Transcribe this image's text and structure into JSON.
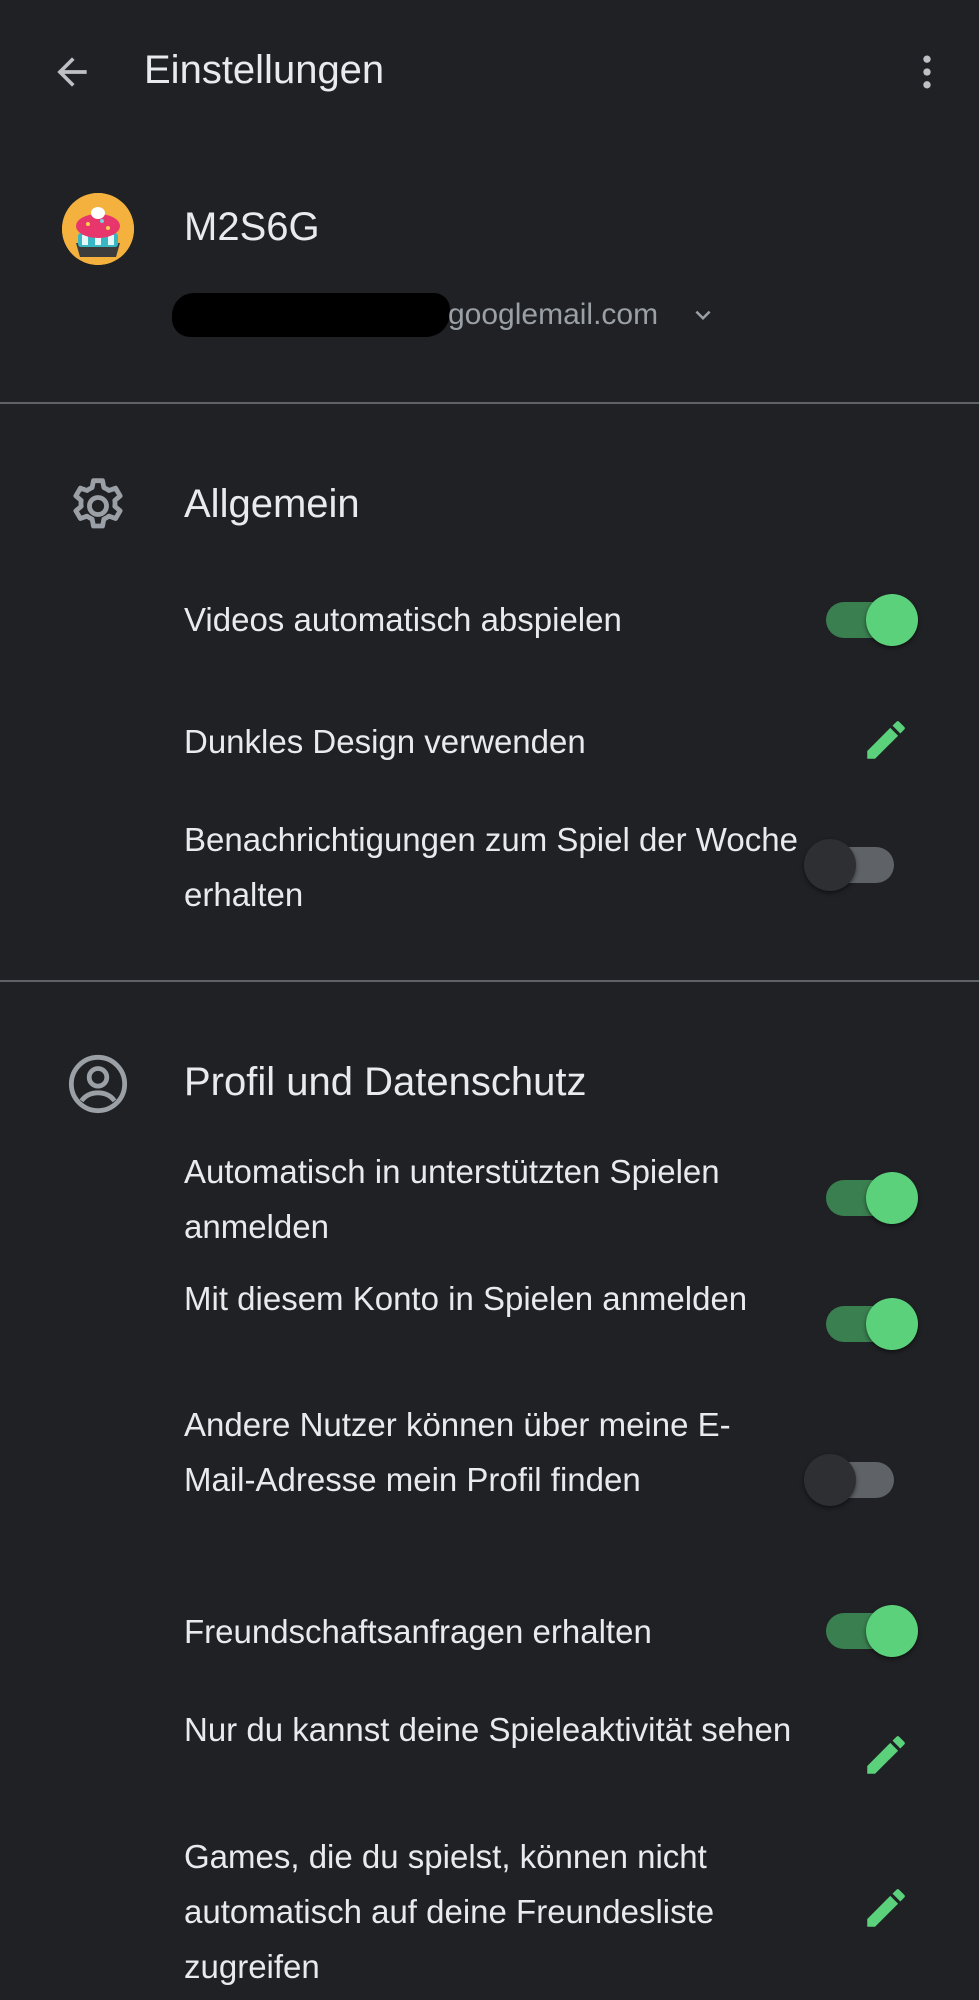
{
  "appbar": {
    "title": "Einstellungen",
    "back_icon": "arrow-back-icon",
    "more_icon": "more-vert-icon"
  },
  "account": {
    "name": "M2S6G",
    "email_visible": "googlemail.com",
    "avatar_icon": "cupcake-avatar-icon",
    "expand_icon": "chevron-down-icon"
  },
  "sections": {
    "general": {
      "title": "Allgemein",
      "icon": "gear-icon",
      "items": [
        {
          "label": "Videos automatisch abspielen",
          "control": "toggle",
          "state": "on"
        },
        {
          "label": "Dunkles Design verwenden",
          "control": "edit",
          "icon": "pencil-icon"
        },
        {
          "label": "Benachrichtigungen zum Spiel der Woche erhalten",
          "control": "toggle",
          "state": "off"
        }
      ]
    },
    "privacy": {
      "title": "Profil und Datenschutz",
      "icon": "account-circle-icon",
      "items": [
        {
          "label": "Automatisch in unterstützten Spielen anmelden",
          "control": "toggle",
          "state": "on"
        },
        {
          "label": "Mit diesem Konto in Spielen anmelden",
          "control": "toggle",
          "state": "on"
        },
        {
          "label": "Andere Nutzer können über meine E-Mail-Adresse mein Profil finden",
          "control": "toggle",
          "state": "off"
        },
        {
          "label": "Freundschaftsanfragen erhalten",
          "control": "toggle",
          "state": "on"
        },
        {
          "label": "Nur du kannst deine Spieleaktivität sehen",
          "control": "edit",
          "icon": "pencil-icon"
        },
        {
          "label": "Games, die du spielst, können nicht automatisch auf deine Freundesliste zugreifen",
          "control": "edit",
          "icon": "pencil-icon"
        }
      ]
    }
  },
  "colors": {
    "background": "#202125",
    "accent": "#5bd17b",
    "text": "#e8eaed",
    "secondary_text": "#9aa0a6",
    "divider": "#5f6368"
  }
}
